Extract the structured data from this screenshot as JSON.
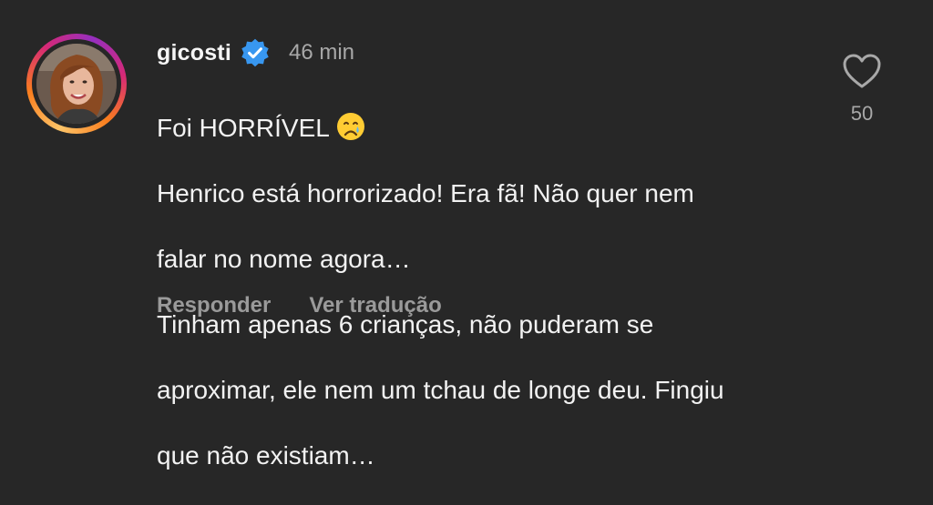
{
  "comment": {
    "username": "gicosti",
    "verified": true,
    "time": "46 min",
    "lines": [
      "Foi HORRÍVEL",
      "Henrico está horrorizado! Era fã! Não quer nem",
      "falar no nome agora…",
      "Tinham apenas 6 crianças, não puderam se",
      "aproximar, ele nem um tchau de longe deu. Fingiu",
      "que não existiam…"
    ],
    "emoji": "crying-face-emoji",
    "actions": {
      "reply": "Responder",
      "translate": "Ver tradução"
    },
    "likes": {
      "icon": "heart-outline-icon",
      "count": "50"
    }
  },
  "colors": {
    "background": "#272727",
    "text": "#f2f2f2",
    "muted": "#a8a8a8",
    "verified_blue": "#3897f0"
  }
}
